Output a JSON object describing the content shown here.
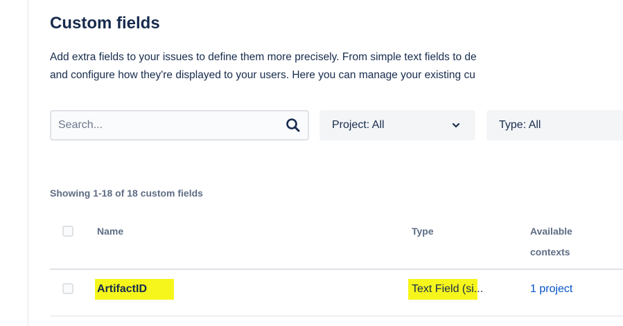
{
  "header": {
    "title": "Custom fields",
    "description_line1": "Add extra fields to your issues to define them more precisely. From simple text fields to de",
    "description_line2": "and configure how they're displayed to your users. Here you can manage your existing cu"
  },
  "filters": {
    "search_placeholder": "Search...",
    "project_label": "Project: All",
    "type_label": "Type: All"
  },
  "summary": {
    "showing_text": "Showing 1-18 of 18 custom fields"
  },
  "table": {
    "columns": {
      "name": "Name",
      "type": "Type",
      "contexts_line1": "Available",
      "contexts_line2": "contexts"
    },
    "rows": [
      {
        "name": "ArtifactID",
        "type": "Text Field (si...",
        "contexts": "1 project"
      }
    ]
  },
  "colors": {
    "highlight": "#f6f61c",
    "link": "#0052cc",
    "text": "#172b4d",
    "muted": "#5e6c84"
  },
  "icons": {
    "search": "search-icon",
    "chevron": "chevron-down-icon"
  }
}
